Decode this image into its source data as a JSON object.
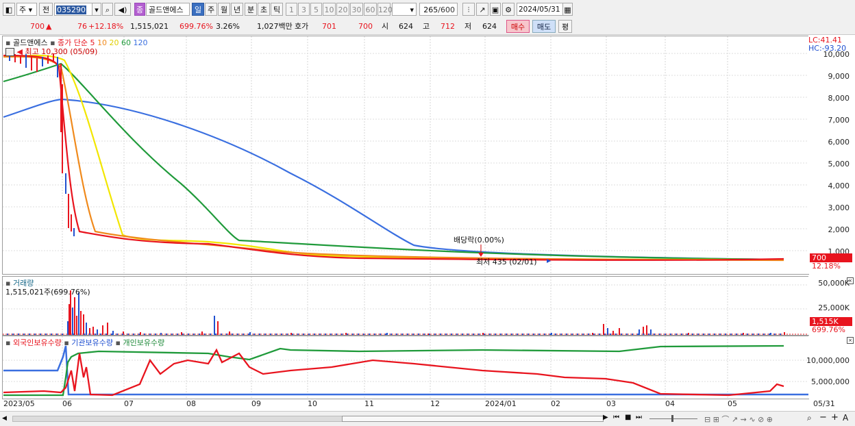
{
  "toolbar": {
    "market": "주",
    "prefix": "전",
    "code": "035290",
    "name": "골드앤에스",
    "badge": "종",
    "periods": [
      "일",
      "주",
      "월",
      "년",
      "분",
      "초",
      "틱"
    ],
    "numbers": [
      "1",
      "3",
      "5",
      "10",
      "20",
      "30",
      "60",
      "120"
    ],
    "count": "265",
    "count_total": "/600",
    "date": "2024/05/31"
  },
  "quote": {
    "price": "700",
    "change": "76",
    "change_pct": "+12.18%",
    "volume": "1,515,021",
    "vol_ratio": "699.76%",
    "turnover": "3.26%",
    "amount": "1,027백만",
    "bid_label": "호가",
    "ask": "701",
    "bid": "700",
    "open_label": "시",
    "open": "624",
    "high_label": "고",
    "high": "712",
    "low_label": "저",
    "low": "624",
    "buy": "매수",
    "sell": "매도",
    "avg": "평"
  },
  "price_pane": {
    "legend_name": "골드앤에스",
    "legend_ma": "종가 단순",
    "ma_periods": [
      "5",
      "10",
      "20",
      "60",
      "120"
    ],
    "ma_colors": [
      "#e8141e",
      "#f08a1c",
      "#f2e600",
      "#1f9a3a",
      "#3a6fe0"
    ],
    "high_note": "최고 10,300 (05/09)",
    "low_note": "최저 435 (02/01)",
    "dividend_note": "배당락(0.00%)",
    "lc": "LC:41.41",
    "hc": "HC:-93.20",
    "y_ticks": [
      "10,000",
      "9,000",
      "8,000",
      "7,000",
      "6,000",
      "5,000",
      "4,000",
      "3,000",
      "2,000",
      "1,000"
    ],
    "price_flag": "700",
    "pct_flag": "12.18%"
  },
  "volume_pane": {
    "title": "거래량",
    "value_line": "1,515,021주(699.76%)",
    "y_ticks": [
      "50,000K",
      "25,000K"
    ],
    "flag": "1,515K",
    "pct": "699.76%"
  },
  "holding_pane": {
    "legend": [
      "외국인보유수량",
      "기관보유수량",
      "개인보유수량"
    ],
    "colors": [
      "#e8141e",
      "#3a6fe0",
      "#1f9a3a"
    ],
    "y_ticks": [
      "10,000,000",
      "5,000,000"
    ]
  },
  "x_axis": {
    "labels": [
      "2023/05",
      "06",
      "07",
      "08",
      "09",
      "10",
      "11",
      "12",
      "2024/01",
      "02",
      "03",
      "04",
      "05"
    ],
    "right": "05/31"
  }
}
